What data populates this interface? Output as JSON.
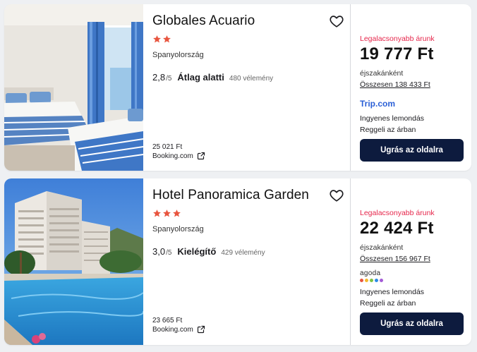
{
  "hotels": [
    {
      "name": "Globales Acuario",
      "stars": 2,
      "country": "Spanyolország",
      "score": "2,8",
      "score_outof": "/5",
      "score_label": "Átlag alatti",
      "reviews": "480 vélemény",
      "alt_price": "25 021 Ft",
      "alt_provider": "Booking.com",
      "lowest_label": "Legalacsonyabb árunk",
      "price": "19 777 Ft",
      "per_night": "éjszakánként",
      "total": "Összesen 138 433 Ft",
      "provider": "Trip.com",
      "features": [
        "Ingyenes lemondás",
        "Reggeli az árban"
      ],
      "cta": "Ugrás az oldalra"
    },
    {
      "name": "Hotel Panoramica Garden",
      "stars": 3,
      "country": "Spanyolország",
      "score": "3,0",
      "score_outof": "/5",
      "score_label": "Kielégítő",
      "reviews": "429 vélemény",
      "alt_price": "23 665 Ft",
      "alt_provider": "Booking.com",
      "lowest_label": "Legalacsonyabb árunk",
      "price": "22 424 Ft",
      "per_night": "éjszakánként",
      "total": "Összesen 156 967 Ft",
      "provider": "agoda",
      "features": [
        "Ingyenes lemondás",
        "Reggeli az árban"
      ],
      "cta": "Ugrás az oldalra"
    }
  ],
  "colors": {
    "star": "#e8553f",
    "accent_red": "#e6264b",
    "button_bg": "#0d1b3e",
    "tripcom_blue": "#2a5fd6",
    "agoda_dots": [
      "#e8553f",
      "#f5b82e",
      "#7cc242",
      "#2a8ae6",
      "#a35bd6"
    ]
  },
  "icons": {
    "favorite": "heart-outline-icon",
    "external": "external-link-icon",
    "star": "star-icon"
  }
}
